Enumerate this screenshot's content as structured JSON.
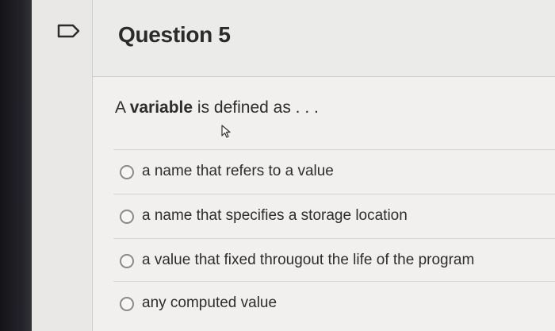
{
  "question": {
    "title": "Question 5",
    "prompt_prefix": "A ",
    "prompt_keyword": "variable",
    "prompt_suffix": " is defined as . . ."
  },
  "answers": [
    {
      "label": "a name that refers to a value",
      "selected": false
    },
    {
      "label": "a name that specifies a storage location",
      "selected": false
    },
    {
      "label": "a value that fixed througout the life of the program",
      "selected": false
    },
    {
      "label": "any computed value",
      "selected": false
    }
  ],
  "icons": {
    "flag": "flag-icon",
    "cursor": "mouse-cursor-icon"
  },
  "colors": {
    "title_text": "#2b2b2b",
    "card_background": "#f1f0ee",
    "divider": "#d6d5d2"
  }
}
